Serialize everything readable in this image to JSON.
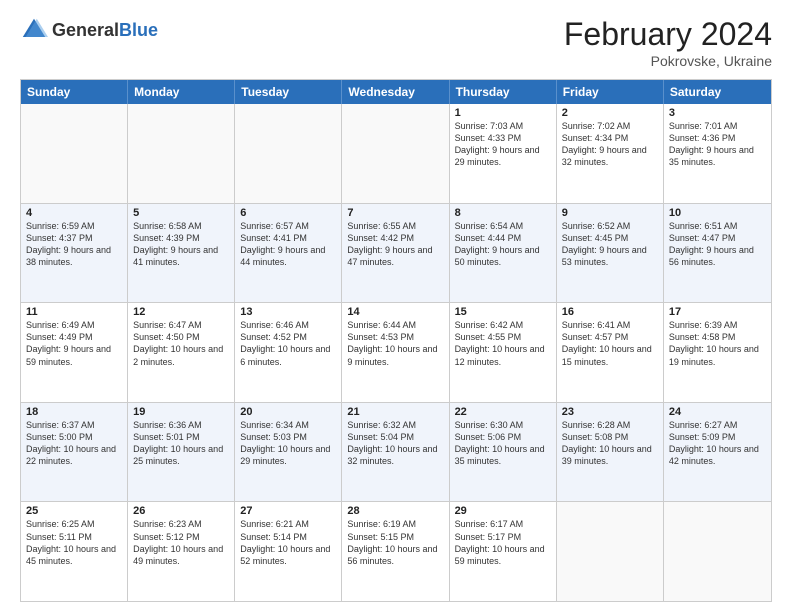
{
  "header": {
    "logo_general": "General",
    "logo_blue": "Blue",
    "month_year": "February 2024",
    "location": "Pokrovske, Ukraine"
  },
  "days_of_week": [
    "Sunday",
    "Monday",
    "Tuesday",
    "Wednesday",
    "Thursday",
    "Friday",
    "Saturday"
  ],
  "rows": [
    [
      {
        "day": "",
        "info": ""
      },
      {
        "day": "",
        "info": ""
      },
      {
        "day": "",
        "info": ""
      },
      {
        "day": "",
        "info": ""
      },
      {
        "day": "1",
        "info": "Sunrise: 7:03 AM\nSunset: 4:33 PM\nDaylight: 9 hours and 29 minutes."
      },
      {
        "day": "2",
        "info": "Sunrise: 7:02 AM\nSunset: 4:34 PM\nDaylight: 9 hours and 32 minutes."
      },
      {
        "day": "3",
        "info": "Sunrise: 7:01 AM\nSunset: 4:36 PM\nDaylight: 9 hours and 35 minutes."
      }
    ],
    [
      {
        "day": "4",
        "info": "Sunrise: 6:59 AM\nSunset: 4:37 PM\nDaylight: 9 hours and 38 minutes."
      },
      {
        "day": "5",
        "info": "Sunrise: 6:58 AM\nSunset: 4:39 PM\nDaylight: 9 hours and 41 minutes."
      },
      {
        "day": "6",
        "info": "Sunrise: 6:57 AM\nSunset: 4:41 PM\nDaylight: 9 hours and 44 minutes."
      },
      {
        "day": "7",
        "info": "Sunrise: 6:55 AM\nSunset: 4:42 PM\nDaylight: 9 hours and 47 minutes."
      },
      {
        "day": "8",
        "info": "Sunrise: 6:54 AM\nSunset: 4:44 PM\nDaylight: 9 hours and 50 minutes."
      },
      {
        "day": "9",
        "info": "Sunrise: 6:52 AM\nSunset: 4:45 PM\nDaylight: 9 hours and 53 minutes."
      },
      {
        "day": "10",
        "info": "Sunrise: 6:51 AM\nSunset: 4:47 PM\nDaylight: 9 hours and 56 minutes."
      }
    ],
    [
      {
        "day": "11",
        "info": "Sunrise: 6:49 AM\nSunset: 4:49 PM\nDaylight: 9 hours and 59 minutes."
      },
      {
        "day": "12",
        "info": "Sunrise: 6:47 AM\nSunset: 4:50 PM\nDaylight: 10 hours and 2 minutes."
      },
      {
        "day": "13",
        "info": "Sunrise: 6:46 AM\nSunset: 4:52 PM\nDaylight: 10 hours and 6 minutes."
      },
      {
        "day": "14",
        "info": "Sunrise: 6:44 AM\nSunset: 4:53 PM\nDaylight: 10 hours and 9 minutes."
      },
      {
        "day": "15",
        "info": "Sunrise: 6:42 AM\nSunset: 4:55 PM\nDaylight: 10 hours and 12 minutes."
      },
      {
        "day": "16",
        "info": "Sunrise: 6:41 AM\nSunset: 4:57 PM\nDaylight: 10 hours and 15 minutes."
      },
      {
        "day": "17",
        "info": "Sunrise: 6:39 AM\nSunset: 4:58 PM\nDaylight: 10 hours and 19 minutes."
      }
    ],
    [
      {
        "day": "18",
        "info": "Sunrise: 6:37 AM\nSunset: 5:00 PM\nDaylight: 10 hours and 22 minutes."
      },
      {
        "day": "19",
        "info": "Sunrise: 6:36 AM\nSunset: 5:01 PM\nDaylight: 10 hours and 25 minutes."
      },
      {
        "day": "20",
        "info": "Sunrise: 6:34 AM\nSunset: 5:03 PM\nDaylight: 10 hours and 29 minutes."
      },
      {
        "day": "21",
        "info": "Sunrise: 6:32 AM\nSunset: 5:04 PM\nDaylight: 10 hours and 32 minutes."
      },
      {
        "day": "22",
        "info": "Sunrise: 6:30 AM\nSunset: 5:06 PM\nDaylight: 10 hours and 35 minutes."
      },
      {
        "day": "23",
        "info": "Sunrise: 6:28 AM\nSunset: 5:08 PM\nDaylight: 10 hours and 39 minutes."
      },
      {
        "day": "24",
        "info": "Sunrise: 6:27 AM\nSunset: 5:09 PM\nDaylight: 10 hours and 42 minutes."
      }
    ],
    [
      {
        "day": "25",
        "info": "Sunrise: 6:25 AM\nSunset: 5:11 PM\nDaylight: 10 hours and 45 minutes."
      },
      {
        "day": "26",
        "info": "Sunrise: 6:23 AM\nSunset: 5:12 PM\nDaylight: 10 hours and 49 minutes."
      },
      {
        "day": "27",
        "info": "Sunrise: 6:21 AM\nSunset: 5:14 PM\nDaylight: 10 hours and 52 minutes."
      },
      {
        "day": "28",
        "info": "Sunrise: 6:19 AM\nSunset: 5:15 PM\nDaylight: 10 hours and 56 minutes."
      },
      {
        "day": "29",
        "info": "Sunrise: 6:17 AM\nSunset: 5:17 PM\nDaylight: 10 hours and 59 minutes."
      },
      {
        "day": "",
        "info": ""
      },
      {
        "day": "",
        "info": ""
      }
    ]
  ]
}
